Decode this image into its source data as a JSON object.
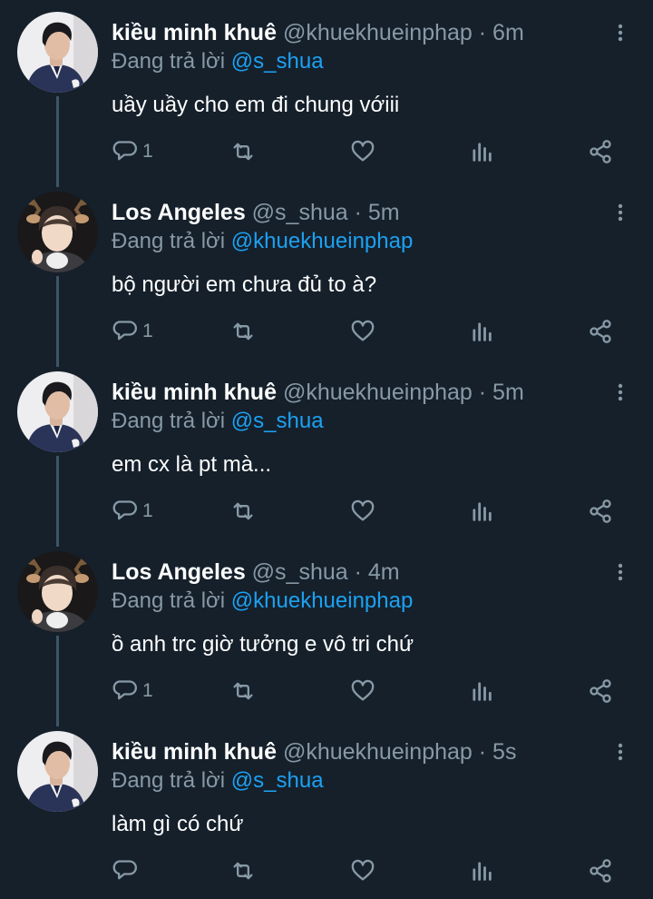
{
  "colors": {
    "background": "#15202b",
    "text": "#ffffff",
    "secondary": "#8899a6",
    "link": "#1da1f2",
    "thread_line": "#3d5466"
  },
  "icons": {
    "reply": "reply-bubble-icon",
    "retweet": "retweet-icon",
    "like": "heart-icon",
    "stats": "analytics-icon",
    "share": "share-icon",
    "more": "more-vertical-icon"
  },
  "tweets": [
    {
      "name": "kiều minh khuê",
      "handle": "@khuekhueinphap",
      "separator": "·",
      "time": "6m",
      "reply_prefix": "Đang trả lời",
      "reply_to": "@s_shua",
      "text": "uầy uầy cho em đi chung vớiii",
      "reply_count": "1",
      "avatar": "avatar-man-suit"
    },
    {
      "name": "Los Angeles",
      "handle": "@s_shua",
      "separator": "·",
      "time": "5m",
      "reply_prefix": "Đang trả lời",
      "reply_to": "@khuekhueinphap",
      "text": "bộ người em chưa đủ to à?",
      "reply_count": "1",
      "avatar": "avatar-deer-antlers"
    },
    {
      "name": "kiều minh khuê",
      "handle": "@khuekhueinphap",
      "separator": "·",
      "time": "5m",
      "reply_prefix": "Đang trả lời",
      "reply_to": "@s_shua",
      "text": "em cx là pt mà...",
      "reply_count": "1",
      "avatar": "avatar-man-suit"
    },
    {
      "name": "Los Angeles",
      "handle": "@s_shua",
      "separator": "·",
      "time": "4m",
      "reply_prefix": "Đang trả lời",
      "reply_to": "@khuekhueinphap",
      "text": "ồ anh trc giờ tưởng e vô tri chứ",
      "reply_count": "1",
      "avatar": "avatar-deer-antlers"
    },
    {
      "name": "kiều minh khuê",
      "handle": "@khuekhueinphap",
      "separator": "·",
      "time": "5s",
      "reply_prefix": "Đang trả lời",
      "reply_to": "@s_shua",
      "text": "làm gì có chứ",
      "reply_count": "",
      "avatar": "avatar-man-suit"
    }
  ]
}
